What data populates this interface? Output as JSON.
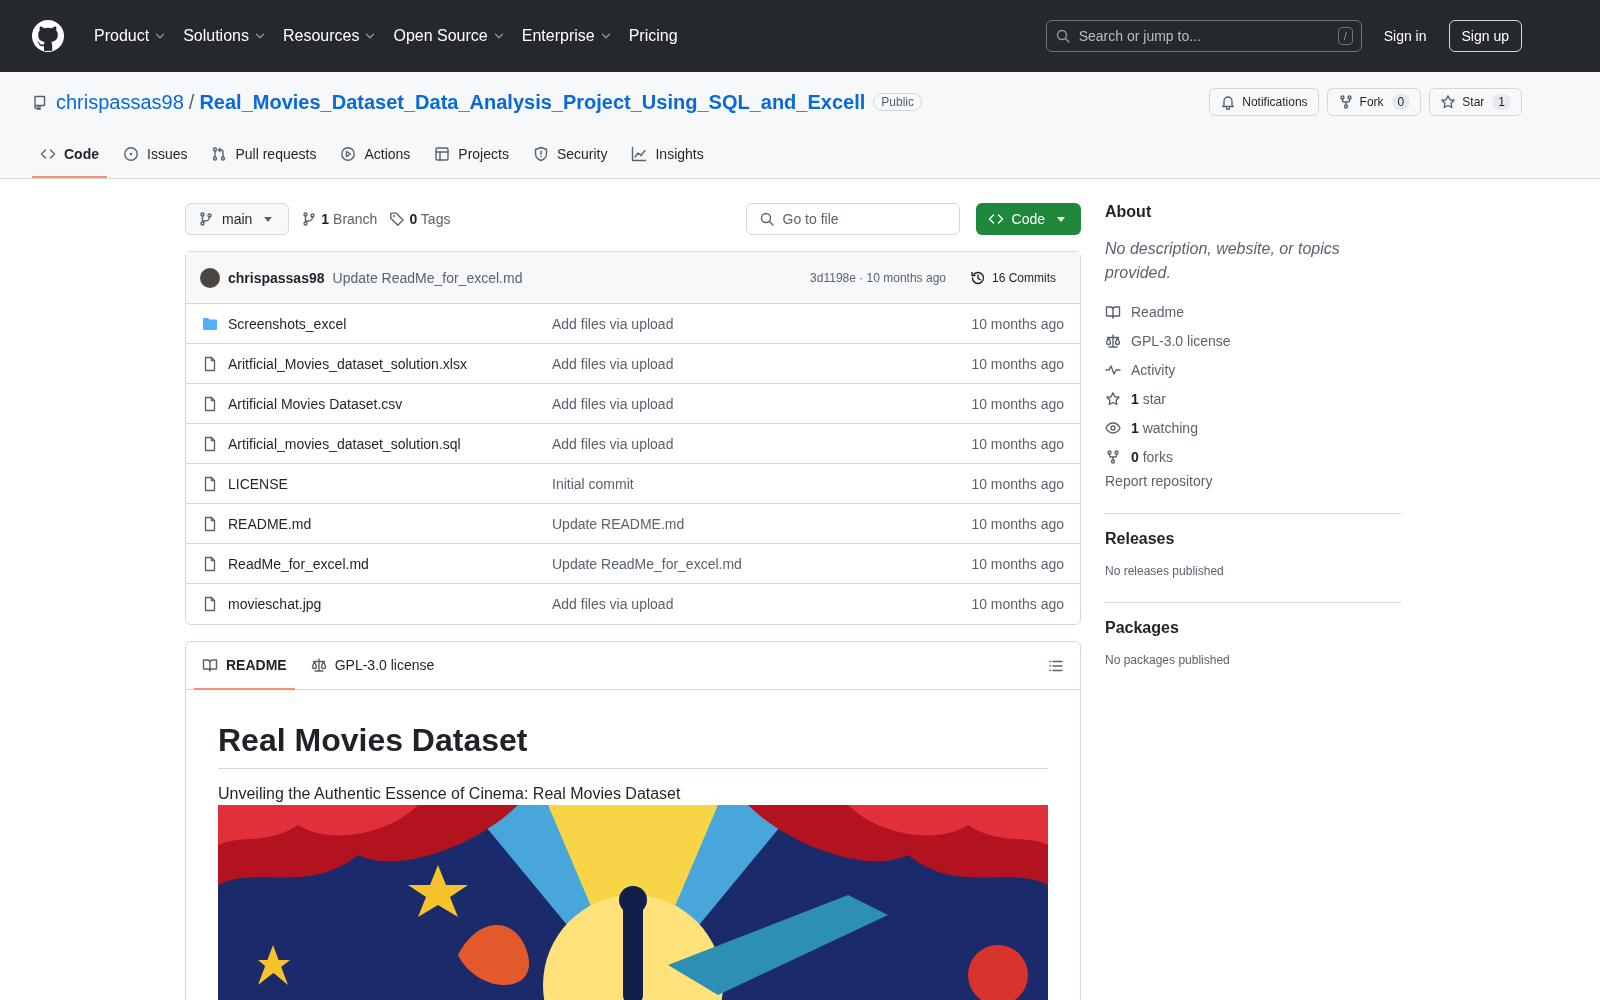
{
  "header": {
    "nav": [
      {
        "label": "Product",
        "dropdown": true
      },
      {
        "label": "Solutions",
        "dropdown": true
      },
      {
        "label": "Resources",
        "dropdown": true
      },
      {
        "label": "Open Source",
        "dropdown": true
      },
      {
        "label": "Enterprise",
        "dropdown": true
      },
      {
        "label": "Pricing",
        "dropdown": false
      }
    ],
    "search": {
      "placeholder": "Search or jump to...",
      "shortcut": "/"
    },
    "sign_in": "Sign in",
    "sign_up": "Sign up"
  },
  "repo": {
    "owner": "chrispassas98",
    "separator": "/",
    "name": "Real_Movies_Dataset_Data_Analysis_Project_Using_SQL_and_Excell",
    "visibility": "Public",
    "actions": [
      {
        "label": "Notifications"
      },
      {
        "label": "Fork",
        "count": "0"
      },
      {
        "label": "Star",
        "count": "1"
      }
    ],
    "tabs": [
      {
        "label": "Code",
        "selected": true
      },
      {
        "label": "Issues",
        "selected": false
      },
      {
        "label": "Pull requests",
        "selected": false
      },
      {
        "label": "Actions",
        "selected": false
      },
      {
        "label": "Projects",
        "selected": false
      },
      {
        "label": "Security",
        "selected": false
      },
      {
        "label": "Insights",
        "selected": false
      }
    ]
  },
  "toolbar": {
    "branch": "main",
    "branches": "**1** Branch",
    "tags": "**0** Tags",
    "go_to_file": "Go to file",
    "code_button": "Code"
  },
  "latest_commit": {
    "author": "chrispassas98",
    "message": "Update ReadMe_for_excel.md",
    "hash_time": "3d1198e · 10 months ago",
    "commits": "16 Commits"
  },
  "files": [
    {
      "kind": "folder",
      "name": "Screenshots_excel",
      "message": "Add files via upload",
      "time": "10 months ago"
    },
    {
      "kind": "file",
      "name": "Aritficial_Movies_dataset_solution.xlsx",
      "message": "Add files via upload",
      "time": "10 months ago"
    },
    {
      "kind": "file",
      "name": "Artificial Movies Dataset.csv",
      "message": "Add files via upload",
      "time": "10 months ago"
    },
    {
      "kind": "file",
      "name": "Artificial_movies_dataset_solution.sql",
      "message": "Add files via upload",
      "time": "10 months ago"
    },
    {
      "kind": "file",
      "name": "LICENSE",
      "message": "Initial commit",
      "time": "10 months ago"
    },
    {
      "kind": "file",
      "name": "README.md",
      "message": "Update README.md",
      "time": "10 months ago"
    },
    {
      "kind": "file",
      "name": "ReadMe_for_excel.md",
      "message": "Update ReadMe_for_excel.md",
      "time": "10 months ago"
    },
    {
      "kind": "file",
      "name": "movieschat.jpg",
      "message": "Add files via upload",
      "time": "10 months ago"
    }
  ],
  "readme": {
    "tabs": [
      {
        "label": "README",
        "selected": true
      },
      {
        "label": "GPL-3.0 license",
        "selected": false
      }
    ],
    "title": "Real Movies Dataset",
    "text": "Unveiling the Authentic Essence of Cinema: Real Movies Dataset"
  },
  "sidebar": {
    "about_title": "About",
    "description": "No description, website, or topics provided.",
    "links": [
      "Readme",
      "GPL-3.0 license",
      "Activity",
      "**1** star",
      "**1** watching",
      "**0** forks"
    ],
    "report": "Report repository",
    "sections": [
      {
        "title": "Releases",
        "note": "No releases published"
      },
      {
        "title": "Packages",
        "note": "No packages published"
      }
    ]
  }
}
